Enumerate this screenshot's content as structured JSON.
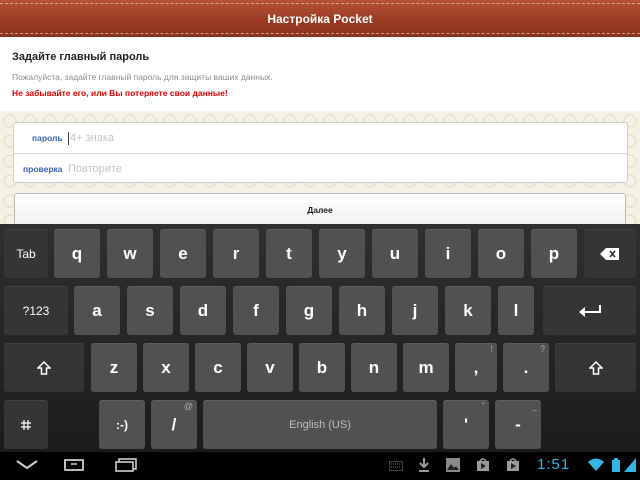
{
  "header": {
    "title": "Настройка Pocket"
  },
  "intro": {
    "heading": "Задайте главный пароль",
    "description": "Пожалуйста, задайте главный пароль для защиты ваших данных.",
    "warning": "Не забывайте его, или Вы потеряете свои данные!"
  },
  "form": {
    "password_label": "пароль",
    "password_placeholder": "4+ знака",
    "confirm_label": "проверка",
    "confirm_placeholder": "Повторите",
    "next_label": "Далее"
  },
  "keyboard": {
    "tab": "Tab",
    "sym": "?123",
    "smiley": ":-)",
    "space": "English (US)",
    "row1": [
      "q",
      "w",
      "e",
      "r",
      "t",
      "y",
      "u",
      "i",
      "o",
      "p"
    ],
    "row2": [
      "a",
      "s",
      "d",
      "f",
      "g",
      "h",
      "j",
      "k",
      "l"
    ],
    "row3": [
      "z",
      "x",
      "c",
      "v",
      "b",
      "n",
      "m",
      "!",
      ","
    ],
    "row3_alt": [
      "!",
      "?"
    ],
    "slash": "/",
    "slash_alt": "@",
    "apostrophe": "'",
    "apostrophe_alt": "\"",
    "dash": "-",
    "dash_alt": "_",
    "row3_last": ".",
    "icons": [
      "backspace-icon",
      "enter-icon",
      "shift-icon",
      "settings-icon"
    ]
  },
  "status": {
    "time": "1:51",
    "accent_color": "#33b5e5"
  }
}
